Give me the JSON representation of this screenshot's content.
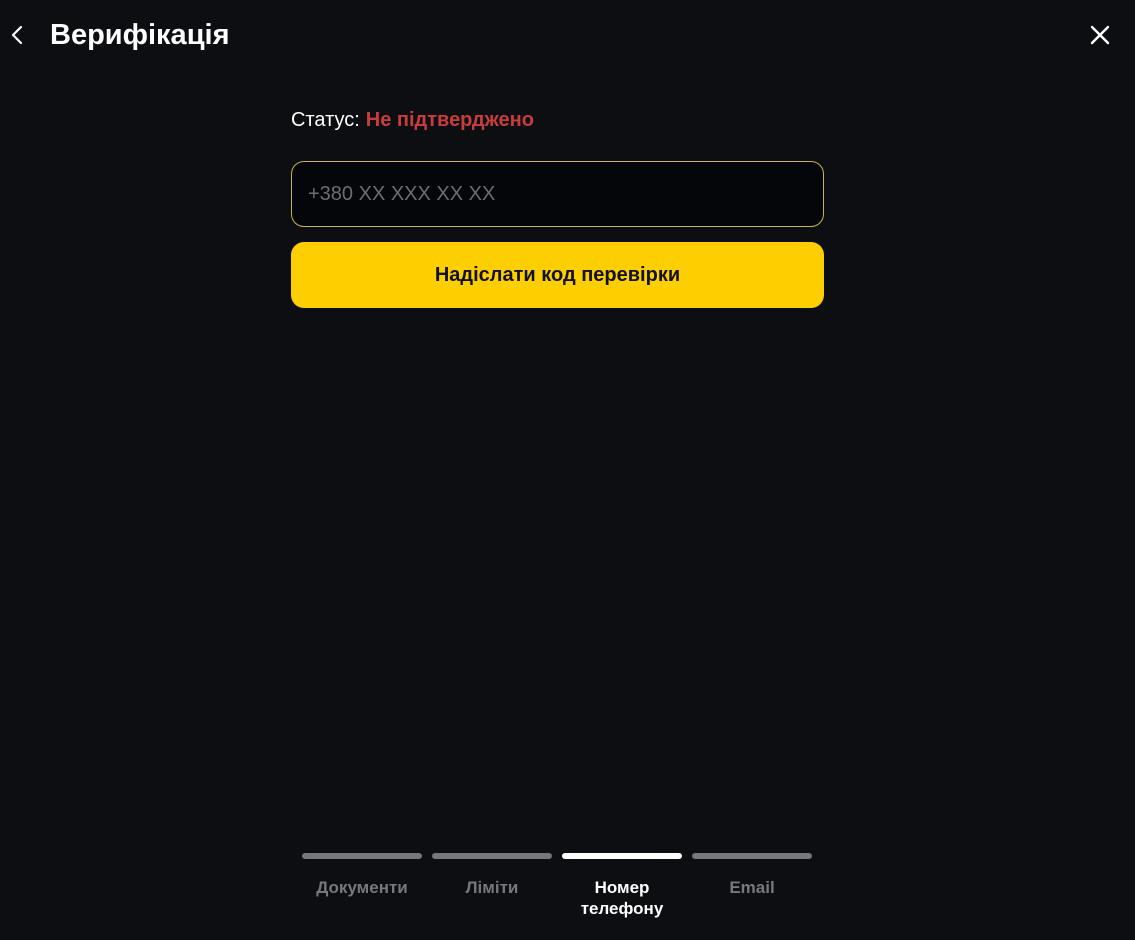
{
  "header": {
    "title": "Верифікація",
    "back_icon": "chevron-left-icon",
    "close_icon": "close-icon"
  },
  "status": {
    "label": "Статус:",
    "value": "Не підтверджено",
    "value_color": "#c93c3c"
  },
  "phone_input": {
    "value": "",
    "placeholder": "+380 XX XXX XX XX"
  },
  "send_button": {
    "label": "Надіслати код перевірки",
    "color": "#fdcf00"
  },
  "steps": [
    {
      "label": "Документи",
      "active": false
    },
    {
      "label": "Ліміти",
      "active": false
    },
    {
      "label": "Номер телефону",
      "active": true
    },
    {
      "label": "Email",
      "active": false
    }
  ]
}
